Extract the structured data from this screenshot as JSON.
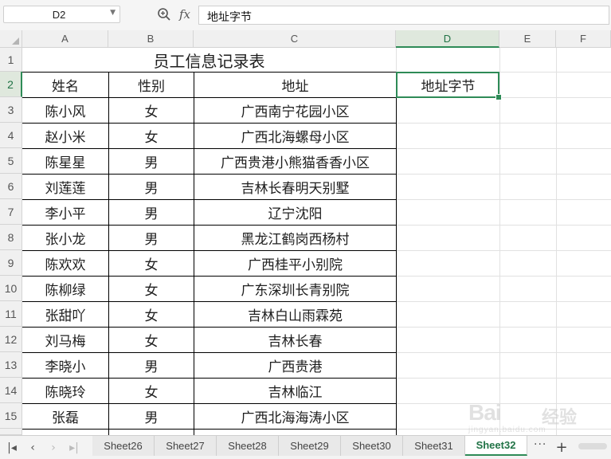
{
  "formula_bar": {
    "name_box": "D2",
    "fx_label": "fx",
    "formula": "地址字节"
  },
  "columns": [
    "A",
    "B",
    "C",
    "D",
    "E",
    "F"
  ],
  "selected_column": "D",
  "selected_row": "2",
  "title": "员工信息记录表",
  "table_header": {
    "name": "姓名",
    "gender": "性别",
    "address": "地址",
    "extra": "地址字节"
  },
  "rows": [
    {
      "num": "3",
      "name": "陈小风",
      "gender": "女",
      "address": "广西南宁花园小区"
    },
    {
      "num": "4",
      "name": "赵小米",
      "gender": "女",
      "address": "广西北海螺母小区"
    },
    {
      "num": "5",
      "name": "陈星星",
      "gender": "男",
      "address": "广西贵港小熊猫香香小区"
    },
    {
      "num": "6",
      "name": "刘莲莲",
      "gender": "男",
      "address": "吉林长春明天别墅"
    },
    {
      "num": "7",
      "name": "李小平",
      "gender": "男",
      "address": "辽宁沈阳"
    },
    {
      "num": "8",
      "name": "张小龙",
      "gender": "男",
      "address": "黑龙江鹤岗西杨村"
    },
    {
      "num": "9",
      "name": "陈欢欢",
      "gender": "女",
      "address": "广西桂平小别院"
    },
    {
      "num": "10",
      "name": "陈柳绿",
      "gender": "女",
      "address": "广东深圳长青别院"
    },
    {
      "num": "11",
      "name": "张甜吖",
      "gender": "女",
      "address": "吉林白山雨霖苑"
    },
    {
      "num": "12",
      "name": "刘马梅",
      "gender": "女",
      "address": "吉林长春"
    },
    {
      "num": "13",
      "name": "李晓小",
      "gender": "男",
      "address": "广西贵港"
    },
    {
      "num": "14",
      "name": "陈晓玲",
      "gender": "女",
      "address": "吉林临江"
    },
    {
      "num": "15",
      "name": "张磊",
      "gender": "男",
      "address": "广西北海海涛小区"
    }
  ],
  "row_labels": [
    "1",
    "2"
  ],
  "sheet_tabs": [
    "Sheet26",
    "Sheet27",
    "Sheet28",
    "Sheet29",
    "Sheet30",
    "Sheet31",
    "Sheet32"
  ],
  "active_sheet": "Sheet32",
  "more_tabs": "···",
  "add_sheet": "+",
  "watermark": {
    "brand": "Bai",
    "brand_cn": "经验",
    "url": "jingyan.baidu.com"
  },
  "colors": {
    "accent": "#2e8b57",
    "header_bg": "#f0f0f0",
    "grid": "#e1e1e1"
  }
}
